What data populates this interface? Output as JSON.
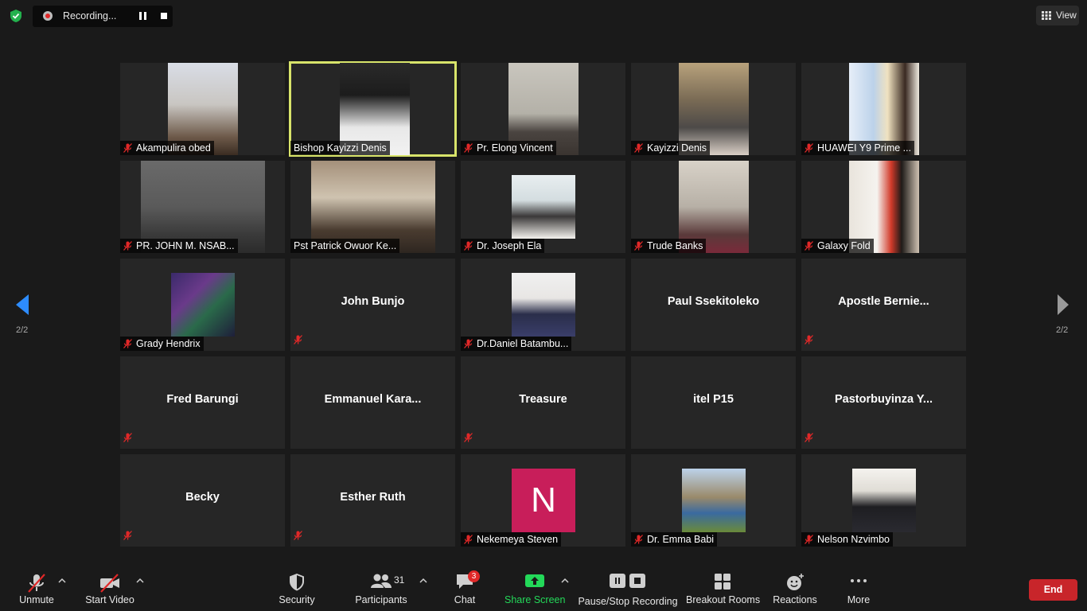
{
  "recording": {
    "status": "Recording..."
  },
  "view": {
    "label": "View"
  },
  "pagination": {
    "current": "2/2"
  },
  "tiles": [
    {
      "name": "Akampulira obed",
      "muted": true,
      "type": "video"
    },
    {
      "name": "Bishop Kayizzi Denis",
      "muted": false,
      "type": "video",
      "active": true
    },
    {
      "name": "Pr. Elong Vincent",
      "muted": true,
      "type": "video"
    },
    {
      "name": "Kayizzi Denis",
      "muted": true,
      "type": "video"
    },
    {
      "name": "HUAWEI Y9 Prime ...",
      "muted": true,
      "type": "video"
    },
    {
      "name": "PR. JOHN M. NSAB...",
      "muted": true,
      "type": "video"
    },
    {
      "name": "Pst Patrick Owuor  Ke...",
      "muted": false,
      "type": "video"
    },
    {
      "name": "Dr. Joseph Ela",
      "muted": true,
      "type": "photo"
    },
    {
      "name": "Trude Banks",
      "muted": true,
      "type": "video"
    },
    {
      "name": "Galaxy Fold",
      "muted": true,
      "type": "video"
    },
    {
      "name": "Grady Hendrix",
      "muted": true,
      "type": "photo"
    },
    {
      "name": "John Bunjo",
      "muted": true,
      "type": "text"
    },
    {
      "name": "Dr.Daniel Batambu...",
      "muted": true,
      "type": "photo"
    },
    {
      "name": "Paul Ssekitoleko",
      "muted": false,
      "type": "text"
    },
    {
      "name": "Apostle  Bernie...",
      "muted": true,
      "type": "text"
    },
    {
      "name": "Fred Barungi",
      "muted": true,
      "type": "text"
    },
    {
      "name": "Emmanuel  Kara...",
      "muted": false,
      "type": "text"
    },
    {
      "name": "Treasure",
      "muted": true,
      "type": "text"
    },
    {
      "name": "itel P15",
      "muted": false,
      "type": "text"
    },
    {
      "name": "Pastorbuyinza  Y...",
      "muted": true,
      "type": "text"
    },
    {
      "name": "Becky",
      "muted": true,
      "type": "text"
    },
    {
      "name": "Esther Ruth",
      "muted": true,
      "type": "text"
    },
    {
      "name": "Nekemeya Steven",
      "muted": true,
      "type": "letter",
      "letter": "N"
    },
    {
      "name": "Dr. Emma Babi",
      "muted": true,
      "type": "photo"
    },
    {
      "name": "Nelson Nzvimbo",
      "muted": true,
      "type": "photo"
    }
  ],
  "toolbar": {
    "unmute": "Unmute",
    "start_video": "Start Video",
    "security": "Security",
    "participants": "Participants",
    "participants_count": "31",
    "chat": "Chat",
    "chat_badge": "3",
    "share_screen": "Share Screen",
    "pause_stop_recording": "Pause/Stop Recording",
    "breakout_rooms": "Breakout Rooms",
    "reactions": "Reactions",
    "more": "More",
    "end": "End"
  },
  "colors": {
    "active_speaker_border": "#d8e46a",
    "end_button": "#c8252a",
    "share_screen": "#23d959",
    "nav_arrow_active": "#2d8cff",
    "muted_icon": "#e02828"
  }
}
